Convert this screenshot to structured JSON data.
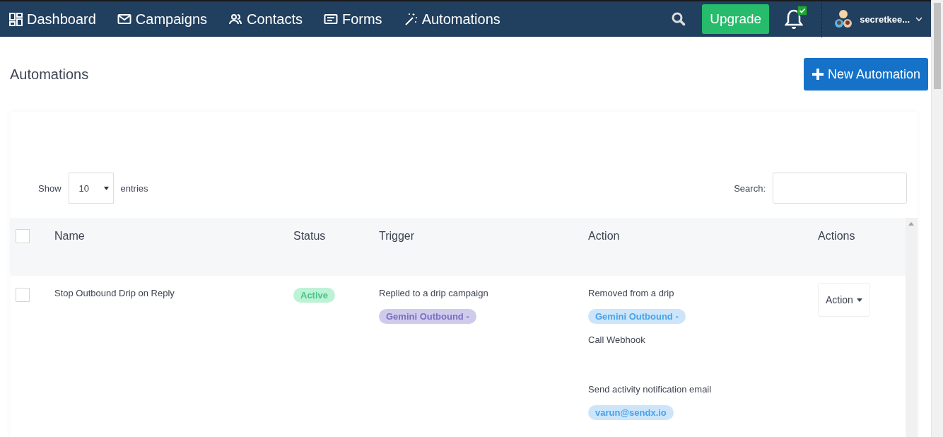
{
  "nav": {
    "items": [
      {
        "label": "Dashboard",
        "kind": "dashboard"
      },
      {
        "label": "Campaigns",
        "kind": "mail"
      },
      {
        "label": "Contacts",
        "kind": "people"
      },
      {
        "label": "Forms",
        "kind": "form"
      },
      {
        "label": "Automations",
        "kind": "wand"
      }
    ],
    "upgrade": "Upgrade",
    "notifications": {
      "has_new": true
    },
    "user": "secretkee..."
  },
  "page": {
    "title": "Automations",
    "new_button": "New Automation"
  },
  "table_controls": {
    "show": "Show",
    "page_size": "10",
    "entries": "entries",
    "search_label": "Search:"
  },
  "table": {
    "columns": [
      "Name",
      "Status",
      "Trigger",
      "Action",
      "Actions"
    ],
    "header_checked": false,
    "rows": [
      {
        "checked": false,
        "name": "Stop Outbound Drip on Reply",
        "status": {
          "text": "Active",
          "kind": "active"
        },
        "trigger": {
          "text": "Replied to a drip campaign",
          "tag": {
            "text": "Gemini Outbound -",
            "color": "#cfcbeb"
          }
        },
        "actions": [
          {
            "text": "Removed from a drip",
            "tag": {
              "text": "Gemini Outbound -",
              "color": "#cce5fb"
            }
          },
          {
            "text": "Call Webhook"
          },
          {
            "text": "Send activity notification email",
            "tag": {
              "text": "varun@sendx.io",
              "color": "#cce5fb"
            }
          }
        ],
        "menu": "Action"
      }
    ]
  }
}
